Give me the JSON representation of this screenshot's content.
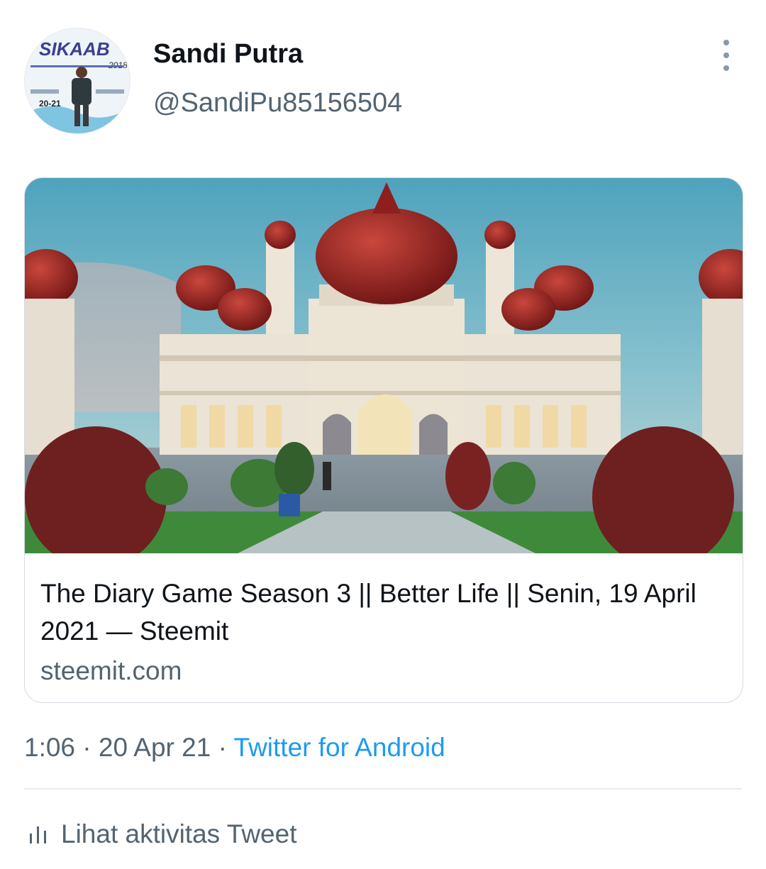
{
  "tweet": {
    "author_name": "Sandi Putra",
    "author_handle": "@SandiPu85156504",
    "avatar_text": "SIKAAB",
    "avatar_year": "2018",
    "avatar_date": "20-21"
  },
  "card": {
    "title": "The Diary Game Season 3 || Better Life || Senin, 19 April 2021 — Steemit",
    "domain": "steemit.com"
  },
  "meta": {
    "time": "1:06",
    "date": "20 Apr 21",
    "separator": "·",
    "source": "Twitter for Android"
  },
  "activity": {
    "label": "Lihat aktivitas Tweet"
  },
  "colors": {
    "link": "#1d9bf0",
    "secondary_text": "#536471",
    "dome_red": "#8e1f1f",
    "sky": "#5aa7c0"
  },
  "icons": {
    "more": "more-vertical-icon",
    "activity": "bar-chart-icon"
  }
}
